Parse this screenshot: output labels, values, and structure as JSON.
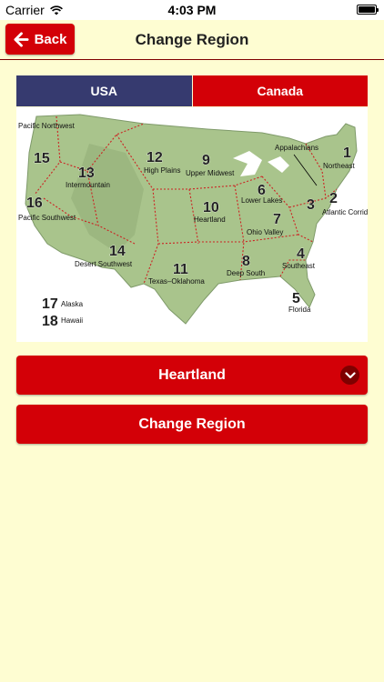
{
  "status_bar": {
    "carrier": "Carrier",
    "time": "4:03 PM"
  },
  "nav": {
    "back_label": "Back",
    "title": "Change Region"
  },
  "tabs": [
    {
      "label": "USA",
      "selected": true
    },
    {
      "label": "Canada",
      "selected": false
    }
  ],
  "map": {
    "regions": [
      {
        "number": "1",
        "name": "Northeast"
      },
      {
        "number": "2",
        "name": "Atlantic Corridor"
      },
      {
        "number": "3",
        "name": "Appalachians"
      },
      {
        "number": "4",
        "name": "Southeast"
      },
      {
        "number": "5",
        "name": "Florida"
      },
      {
        "number": "6",
        "name": "Lower Lakes"
      },
      {
        "number": "7",
        "name": "Ohio Valley"
      },
      {
        "number": "8",
        "name": "Deep South"
      },
      {
        "number": "9",
        "name": "Upper Midwest"
      },
      {
        "number": "10",
        "name": "Heartland"
      },
      {
        "number": "11",
        "name": "Texas–Oklahoma"
      },
      {
        "number": "12",
        "name": "High Plains"
      },
      {
        "number": "13",
        "name": "Intermountain"
      },
      {
        "number": "14",
        "name": "Desert Southwest"
      },
      {
        "number": "15",
        "name": "Pacific Northwest"
      },
      {
        "number": "16",
        "name": "Pacific Southwest"
      },
      {
        "number": "17",
        "name": "Alaska"
      },
      {
        "number": "18",
        "name": "Hawaii"
      }
    ]
  },
  "selected_region": "Heartland",
  "change_button_label": "Change Region",
  "colors": {
    "background": "#fefdd2",
    "accent_red": "#d30007",
    "tab_blue": "#363a6f",
    "map_land": "#a9c48c"
  },
  "icons": {
    "back": "arrow-left-icon",
    "dropdown": "chevron-down-icon",
    "wifi": "wifi-icon",
    "battery": "battery-icon"
  }
}
